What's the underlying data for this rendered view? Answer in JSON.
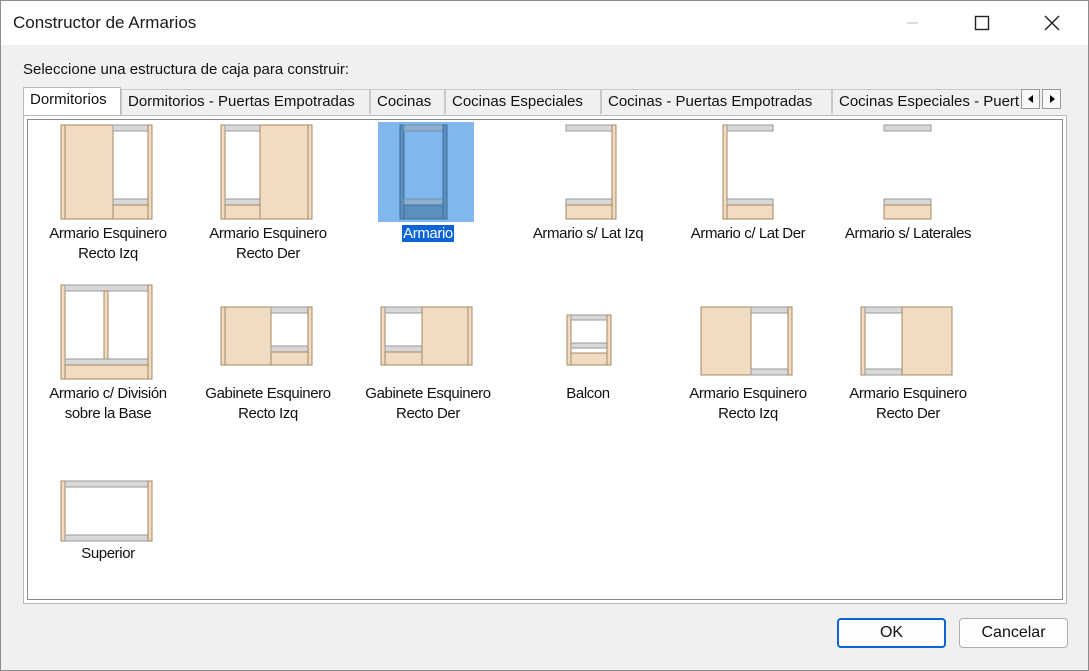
{
  "window": {
    "title": "Constructor de Armarios"
  },
  "prompt": "Seleccione una estructura de caja para construir:",
  "tabs": [
    {
      "label": "Dormitorios"
    },
    {
      "label": "Dormitorios - Puertas Empotradas"
    },
    {
      "label": "Cocinas"
    },
    {
      "label": "Cocinas Especiales"
    },
    {
      "label": "Cocinas - Puertas Empotradas"
    },
    {
      "label": "Cocinas Especiales - Puertas Empotradas"
    }
  ],
  "items": [
    {
      "label1": "Armario Esquinero",
      "label2": "Recto Izq",
      "icon": "armario-esquinero-recto-izq-icon"
    },
    {
      "label1": "Armario Esquinero",
      "label2": "Recto Der",
      "icon": "armario-esquinero-recto-der-icon"
    },
    {
      "label1": "Armario",
      "label2": "",
      "icon": "armario-icon",
      "selected": true
    },
    {
      "label1": "Armario s/ Lat Izq",
      "label2": "",
      "icon": "armario-sin-lat-izq-icon"
    },
    {
      "label1": "Armario c/ Lat Der",
      "label2": "",
      "icon": "armario-con-lat-der-icon"
    },
    {
      "label1": "Armario s/ Laterales",
      "label2": "",
      "icon": "armario-sin-laterales-icon"
    },
    {
      "label1": "Armario c/ División",
      "label2": "sobre la Base",
      "icon": "armario-division-icon"
    },
    {
      "label1": "Gabinete Esquinero",
      "label2": "Recto Izq",
      "icon": "gabinete-esquinero-recto-izq-icon"
    },
    {
      "label1": "Gabinete Esquinero",
      "label2": "Recto Der",
      "icon": "gabinete-esquinero-recto-der-icon"
    },
    {
      "label1": "Balcon",
      "label2": "",
      "icon": "balcon-icon"
    },
    {
      "label1": "Armario Esquinero",
      "label2": "Recto Izq",
      "icon": "armario-esquinero-recto-izq-2-icon"
    },
    {
      "label1": "Armario Esquinero",
      "label2": "Recto Der",
      "icon": "armario-esquinero-recto-der-2-icon"
    },
    {
      "label1": "Superior",
      "label2": "",
      "icon": "superior-icon"
    }
  ],
  "buttons": {
    "ok": "OK",
    "cancel": "Cancelar"
  },
  "colors": {
    "wood": "#efdcc2",
    "wood_edge": "#a4865f",
    "shelf": "#d8d8d8",
    "selection": "#0a64d6",
    "selection_thumb": "#7fb7ee"
  }
}
